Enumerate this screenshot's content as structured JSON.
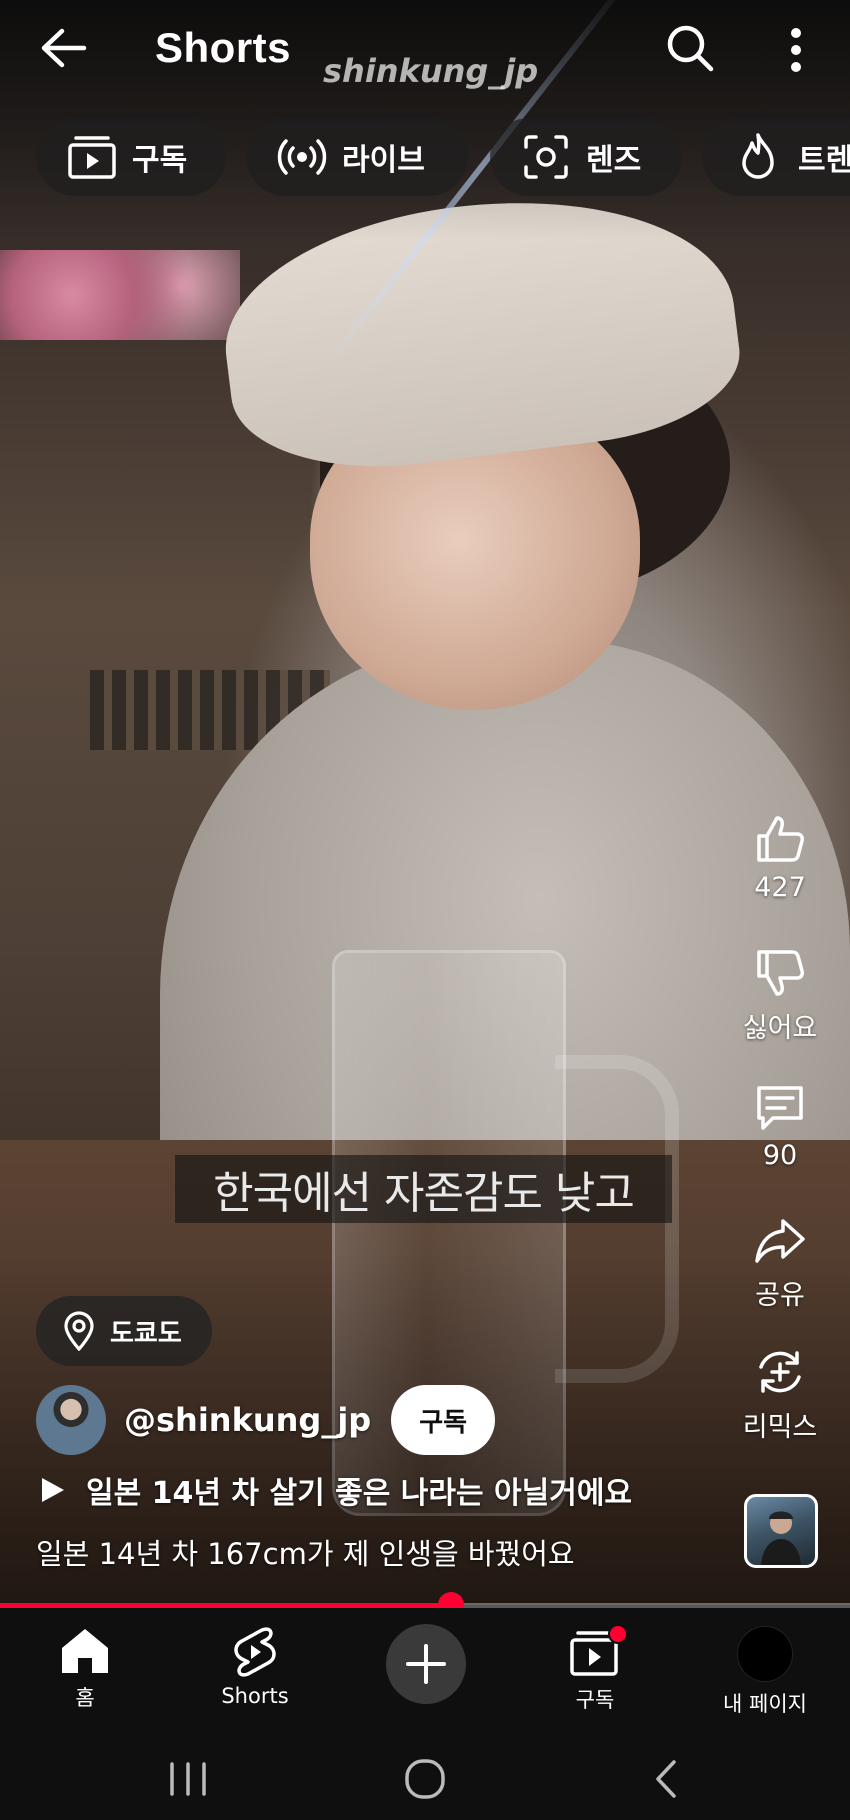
{
  "header": {
    "title": "Shorts",
    "watermark": "shinkung_jp"
  },
  "chips": [
    {
      "label": "구독",
      "icon": "subscriptions-icon"
    },
    {
      "label": "라이브",
      "icon": "live-icon"
    },
    {
      "label": "렌즈",
      "icon": "lens-icon"
    },
    {
      "label": "트렌",
      "icon": "trending-icon"
    }
  ],
  "subtitle": "한국에선 자존감도 낮고",
  "actions": {
    "like": {
      "label": "427",
      "icon": "thumbs-up-icon"
    },
    "dislike": {
      "label": "싫어요",
      "icon": "thumbs-down-icon"
    },
    "comment": {
      "label": "90",
      "icon": "comment-icon"
    },
    "share": {
      "label": "공유",
      "icon": "share-icon"
    },
    "remix": {
      "label": "리믹스",
      "icon": "remix-icon"
    }
  },
  "location": {
    "label": "도쿄도",
    "icon": "location-pin-icon"
  },
  "channel": {
    "handle": "@shinkung_jp",
    "subscribe_label": "구독"
  },
  "video": {
    "title": "일본 14년 차 살기 좋은 나라는 아닐거에요",
    "description": "일본 14년 차 167cm가 제 인생을 바꿨어요",
    "progress_fraction": 0.53
  },
  "bottom_nav": {
    "home": "홈",
    "shorts": "Shorts",
    "subscriptions": "구독",
    "me": "내 페이지"
  },
  "colors": {
    "accent": "#ff0033",
    "nav_bg": "#0f0f0f"
  }
}
